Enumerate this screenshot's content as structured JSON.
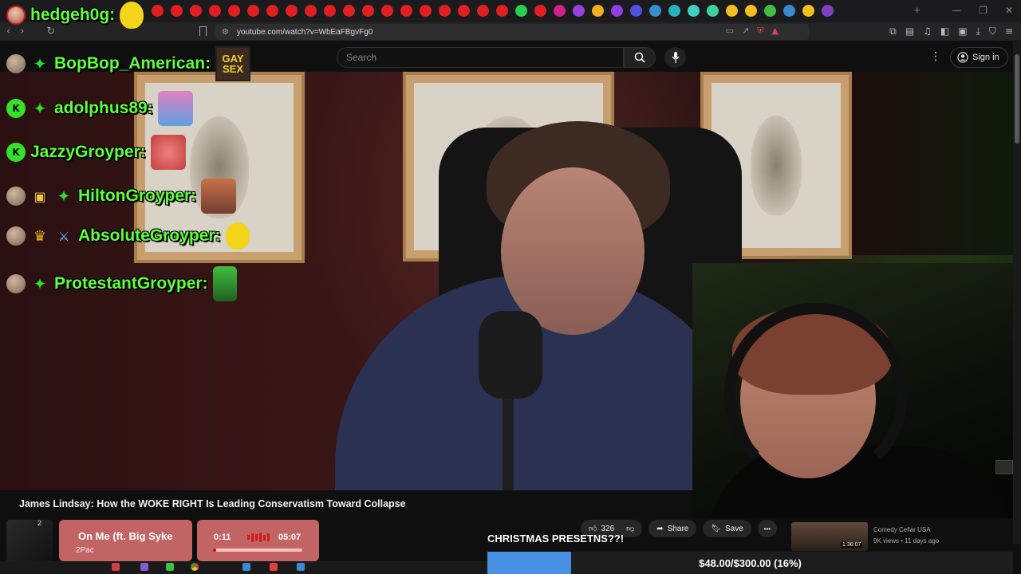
{
  "browser": {
    "url": "youtube.com/watch?v=WbEaFBgvFg0",
    "tab_icon_colors": [
      "#e02020",
      "#e02020",
      "#e02020",
      "#e02020",
      "#e02020",
      "#e02020",
      "#e02020",
      "#e02020",
      "#e02020",
      "#e02020",
      "#e02020",
      "#e02020",
      "#e02020",
      "#e02020",
      "#e02020",
      "#e02020",
      "#e02020",
      "#e02020",
      "#e02020",
      "#2bd04a",
      "#e02020",
      "#d0208a",
      "#9a40e0",
      "#f0b020",
      "#9040e0",
      "#5050e0",
      "#3a8ad0",
      "#2ab0c0",
      "#40d0c0",
      "#40d0a0",
      "#f0c020",
      "#f0c020",
      "#40c040",
      "#3a8ad0",
      "#f0c020",
      "#8040c0",
      "#40b060",
      "#3a8ad0"
    ],
    "new_tab_label": "+",
    "window_controls": [
      "—",
      "❐",
      "✕"
    ],
    "nav": {
      "back": "‹",
      "forward": "›",
      "reload": "↻",
      "bookmark": "🔖"
    }
  },
  "youtube": {
    "search_placeholder": "Search",
    "signin_label": "Sign in",
    "video_title": "James Lindsay: How the WOKE RIGHT Is Leading Conservatism Toward Collapse",
    "like_count": "326",
    "share_label": "Share",
    "save_label": "Save",
    "more_label": "•••",
    "recommended": {
      "channel": "Comedy Cellar USA",
      "meta": "9K views • 11 days ago",
      "duration": "1:36:07"
    }
  },
  "stream_overlay": {
    "streamer_name": "hedgeh0g:",
    "chat": [
      {
        "badges": [
          "avatar",
          "sparkle"
        ],
        "username": "BopBop_American:",
        "emote": "GAY SEX"
      },
      {
        "badges": [
          "k",
          "sparkle"
        ],
        "username": "adolphus89:",
        "emote": ""
      },
      {
        "badges": [
          "k"
        ],
        "username": "JazzyGroyper:",
        "emote": ""
      },
      {
        "badges": [
          "avatar",
          "gift",
          "sparkle"
        ],
        "username": "HiltonGroyper:",
        "emote": ""
      },
      {
        "badges": [
          "avatar",
          "crown",
          "sword"
        ],
        "username": "AbsoluteGroyper:",
        "emote": ""
      },
      {
        "badges": [
          "avatar",
          "sparkle"
        ],
        "username": "ProtestantGroyper:",
        "emote": ""
      }
    ],
    "music": {
      "album_label": "2",
      "title": "On Me (ft. Big Syke",
      "artist": "2Pac",
      "elapsed": "0:11",
      "total": "05:07",
      "progress": 0.036
    },
    "christmas_text": "CHRISTMAS PRESETNS??!",
    "goal": {
      "text": "$48.00/$300.00 (16%)",
      "fraction": 0.16,
      "fill_color": "#4a90e2"
    }
  }
}
